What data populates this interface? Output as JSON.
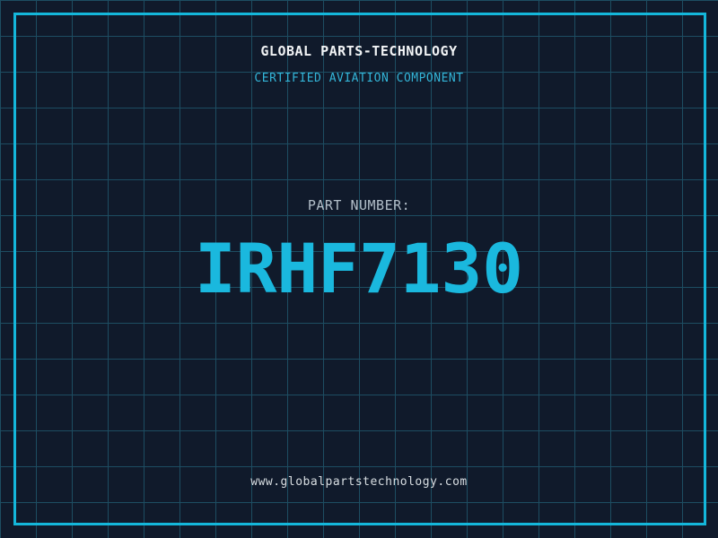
{
  "card": {
    "header": {
      "title": "GLOBAL PARTS-TECHNOLOGY",
      "subtitle": "CERTIFIED AVIATION COMPONENT"
    },
    "part": {
      "label": "PART NUMBER:",
      "number": "IRHF7130"
    },
    "footer": {
      "url": "www.globalpartstechnology.com"
    }
  },
  "colors": {
    "background": "#101a2b",
    "grid_line": "#1d4d62",
    "frame_border": "#14b7db",
    "title_text": "#f2f4f6",
    "subtitle_text": "#33b5d8",
    "part_label_text": "#b3bfc9",
    "part_number_text": "#1ab8de",
    "url_text": "#d8dee2"
  },
  "layout_meta": {
    "grid_cell_px": "40",
    "frame_style": "blueprint"
  }
}
